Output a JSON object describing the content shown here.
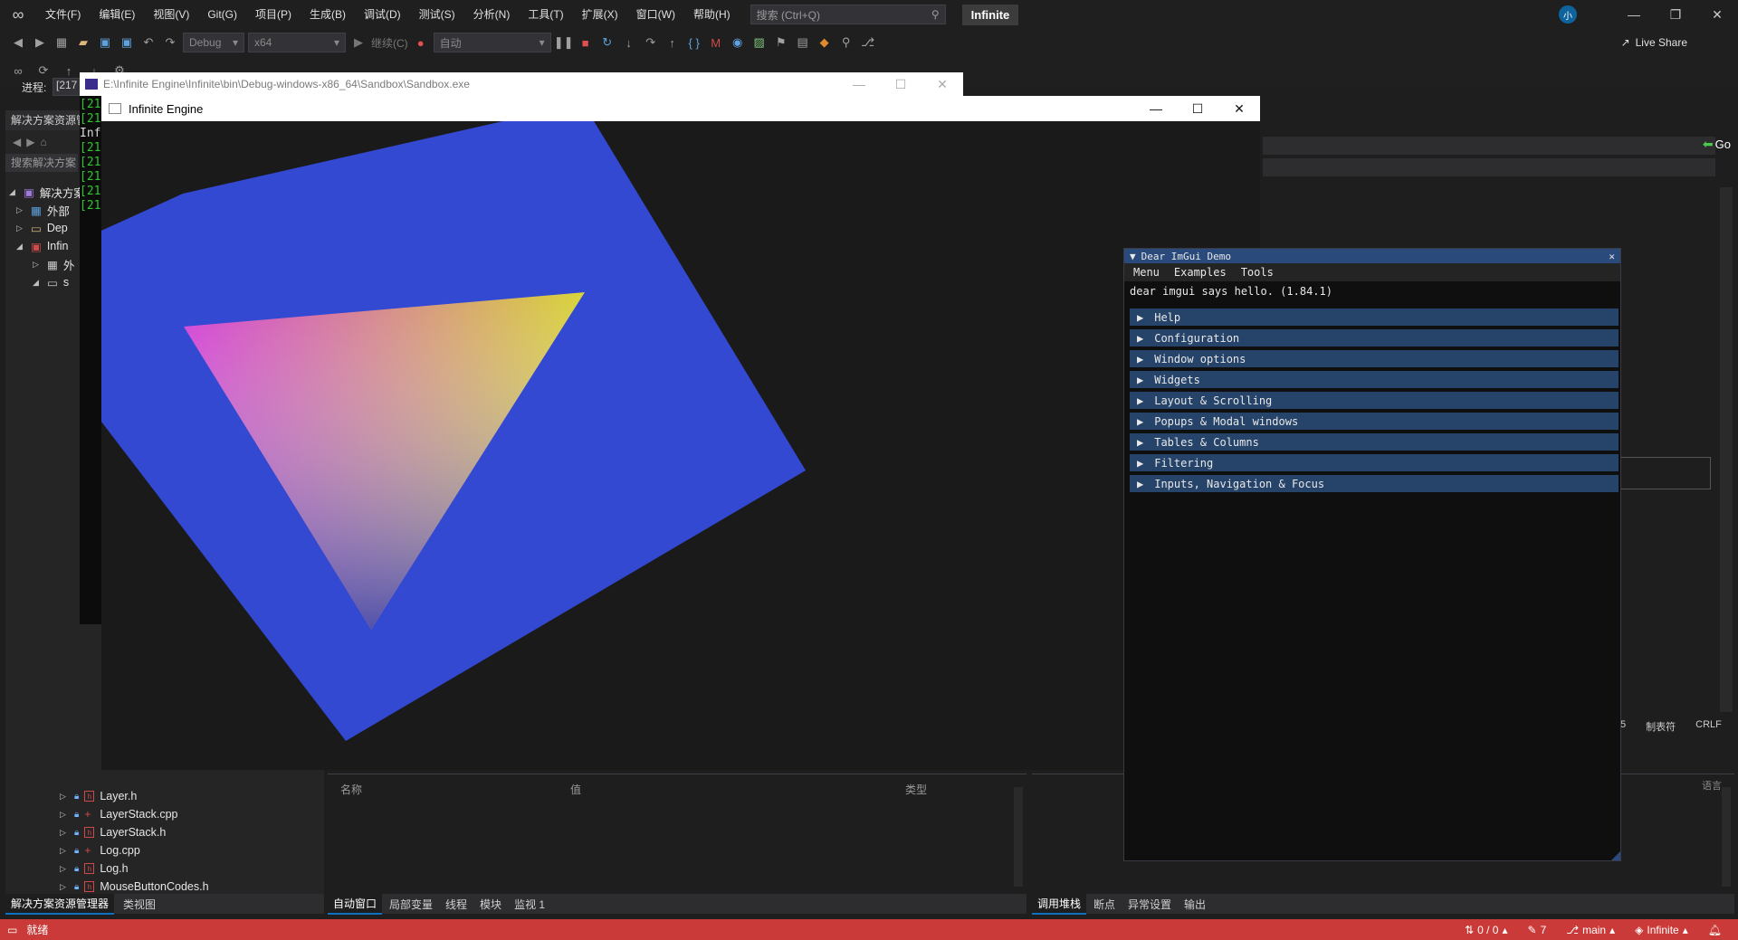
{
  "vs": {
    "menu": [
      "文件(F)",
      "编辑(E)",
      "视图(V)",
      "Git(G)",
      "项目(P)",
      "生成(B)",
      "调试(D)",
      "测试(S)",
      "分析(N)",
      "工具(T)",
      "扩展(X)",
      "窗口(W)",
      "帮助(H)"
    ],
    "search_placeholder": "搜索 (Ctrl+Q)",
    "solution_name": "Infinite",
    "config": "Debug",
    "platform": "x64",
    "continue_label": "继续(C)",
    "auto_label": "自动",
    "liveshare": "Live Share",
    "process_label": "进程:",
    "process_value": "[217",
    "go_label": "Go"
  },
  "solution_explorer": {
    "title": "解决方案资源管",
    "search_placeholder": "搜索解决方案",
    "nodes": [
      "解决方案",
      "外部",
      "Dep",
      "Infin",
      "外",
      "s"
    ],
    "files": [
      "Layer.h",
      "LayerStack.cpp",
      "LayerStack.h",
      "Log.cpp",
      "Log.h",
      "MouseButtonCodes.h"
    ],
    "tabs": [
      "解决方案资源管理器",
      "类视图"
    ]
  },
  "autos": {
    "columns": [
      "名称",
      "值",
      "类型"
    ],
    "tabs": [
      "自动窗口",
      "局部变量",
      "线程",
      "模块",
      "监视 1"
    ]
  },
  "callstack": {
    "tabs": [
      "调用堆栈",
      "断点",
      "异常设置",
      "输出"
    ],
    "lang_label": "语言"
  },
  "editor_status": {
    "col": "5",
    "tab": "制表符",
    "eol": "CRLF"
  },
  "statusbar": {
    "ready": "就绪",
    "sync": "0 / 0",
    "edits": "7",
    "branch": "main",
    "repo": "Infinite"
  },
  "console": {
    "title": "E:\\Infinite Engine\\Infinite\\bin\\Debug-windows-x86_64\\Sandbox\\Sandbox.exe",
    "lines": [
      "[21",
      "[21",
      "Inf",
      "[21",
      "[21",
      "[21",
      "[21",
      "[21"
    ]
  },
  "engine": {
    "title": "Infinite Engine"
  },
  "imgui": {
    "title": "Dear ImGui Demo",
    "menu": [
      "Menu",
      "Examples",
      "Tools"
    ],
    "hello": "dear imgui says hello. (1.84.1)",
    "headers": [
      "Help",
      "Configuration",
      "Window options",
      "Widgets",
      "Layout & Scrolling",
      "Popups & Modal windows",
      "Tables & Columns",
      "Filtering",
      "Inputs, Navigation & Focus"
    ]
  },
  "colors": {
    "statusbar": "#ca3a38",
    "quad": "#3349d1",
    "imgui_header": "#26436a",
    "imgui_title": "#294a7a"
  }
}
